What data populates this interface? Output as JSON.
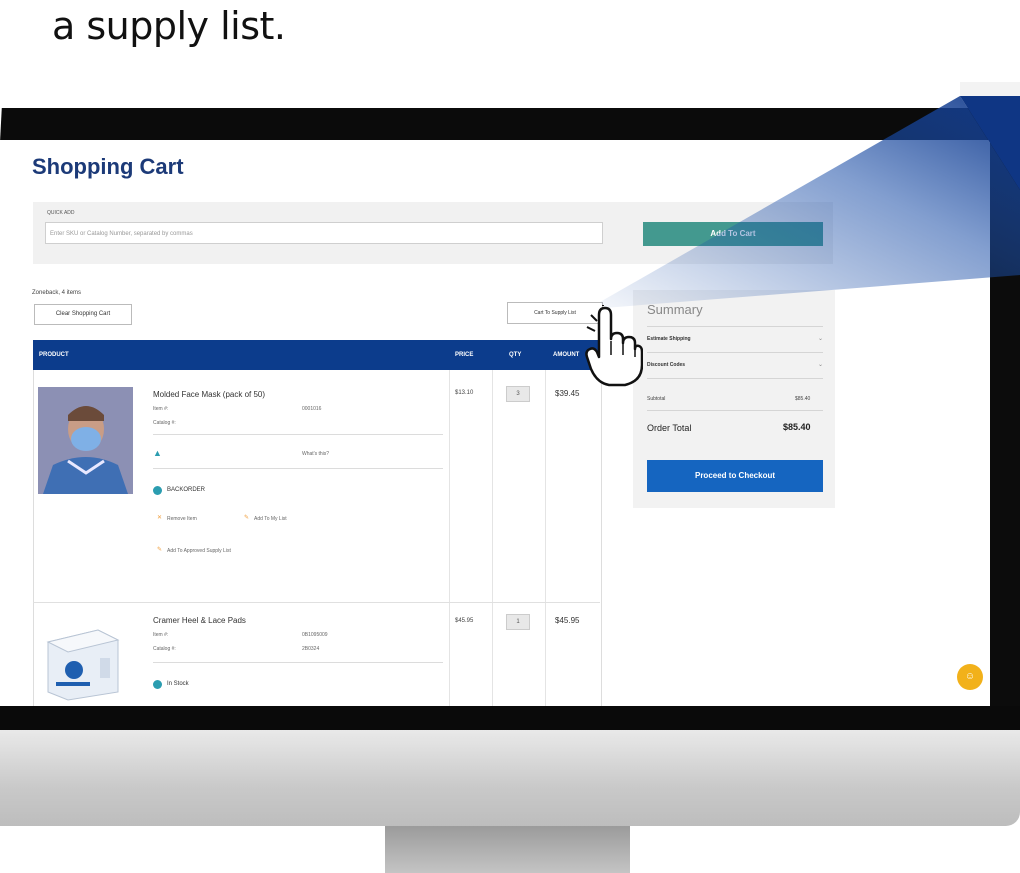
{
  "caption": "a supply list.",
  "app": {
    "page_title": "Shopping Cart",
    "quick_add": {
      "label": "QUICK ADD",
      "placeholder": "Enter SKU or Catalog Number, separated by commas",
      "add_button": "Add To Cart"
    },
    "items_count": "Zoneback, 4 items",
    "clear_cart_button": "Clear Shopping Cart",
    "cart_to_supply_button": "Cart To Supply List",
    "table": {
      "headers": [
        "PRODUCT",
        "PRICE",
        "QTY",
        "AMOUNT"
      ],
      "rows": [
        {
          "name": "Molded Face Mask (pack of 50)",
          "item_label": "Item #:",
          "item_value": "0001016",
          "catalog_label": "Catalog #:",
          "catalog_value": "",
          "link": "What's this?",
          "price": "$13.10",
          "qty": "3",
          "amount": "$39.45",
          "status": "BACKORDER",
          "actions": [
            "Remove Item",
            "Add To My List",
            "Add To Approved Supply List"
          ]
        },
        {
          "name": "Cramer Heel & Lace Pads",
          "item_label": "Item #:",
          "item_value": "0B1095009",
          "catalog_label": "Catalog #:",
          "catalog_value": "2B0324",
          "price": "$45.95",
          "qty": "1",
          "amount": "$45.95",
          "status": "In Stock"
        }
      ]
    },
    "summary": {
      "title": "Summary",
      "estimate_shipping": "Estimate Shipping",
      "discount_codes": "Discount Codes",
      "subtotal_label": "Subtotal",
      "subtotal_value": "$85.40",
      "order_total_label": "Order Total",
      "order_total_value": "$85.40",
      "checkout_button": "Proceed to Checkout"
    }
  },
  "colors": {
    "title_blue": "#1c3a78",
    "table_header": "#0c3c8c",
    "add_button": "#43998f",
    "checkout_button": "#1565c0",
    "status_teal": "#2b9db0",
    "help_button": "#f2b11a"
  },
  "icons": [
    "hand-pointer-icon",
    "chevron-down-icon",
    "warning-triangle-icon",
    "status-dot-icon",
    "help-icon"
  ]
}
